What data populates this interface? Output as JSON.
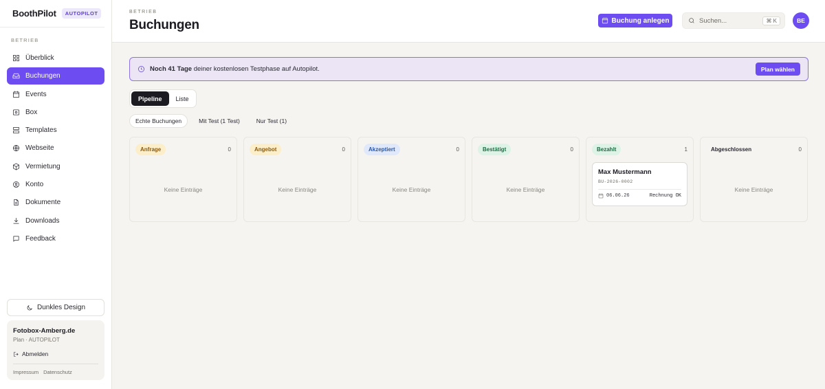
{
  "brand": {
    "name": "BoothPilot",
    "badge": "AUTOPILOT"
  },
  "sidebar": {
    "section_label": "BETRIEB",
    "items": [
      {
        "label": "Überblick",
        "icon": "grid-icon",
        "active": false
      },
      {
        "label": "Buchungen",
        "icon": "inbox-icon",
        "active": true
      },
      {
        "label": "Events",
        "icon": "calendar-icon",
        "active": false
      },
      {
        "label": "Box",
        "icon": "box-icon",
        "active": false
      },
      {
        "label": "Templates",
        "icon": "layout-icon",
        "active": false
      },
      {
        "label": "Webseite",
        "icon": "globe-icon",
        "active": false
      },
      {
        "label": "Vermietung",
        "icon": "package-icon",
        "active": false
      },
      {
        "label": "Konto",
        "icon": "user-circle-icon",
        "active": false
      },
      {
        "label": "Dokumente",
        "icon": "document-icon",
        "active": false
      },
      {
        "label": "Downloads",
        "icon": "download-icon",
        "active": false
      },
      {
        "label": "Feedback",
        "icon": "message-icon",
        "active": false
      }
    ],
    "dark_mode_label": "Dunkles Design",
    "account": {
      "name": "Fotobox-Amberg.de",
      "plan": "Plan · AUTOPILOT",
      "logout_label": "Abmelden",
      "links": [
        "Impressum",
        "Datenschutz"
      ]
    }
  },
  "header": {
    "breadcrumb": "BETRIEB",
    "title": "Buchungen",
    "create_button": "Buchung anlegen",
    "search_placeholder": "Suchen...",
    "search_shortcut": "⌘ K",
    "avatar_initials": "BE"
  },
  "trial": {
    "bold": "Noch 41 Tage",
    "text": " deiner kostenlosen Testphase auf Autopilot.",
    "button": "Plan wählen"
  },
  "view_toggle": [
    {
      "label": "Pipeline",
      "active": true
    },
    {
      "label": "Liste",
      "active": false
    }
  ],
  "filters": [
    {
      "label": "Echte Buchungen",
      "active": true
    },
    {
      "label": "Mit Test (1 Test)",
      "active": false
    },
    {
      "label": "Nur Test (1)",
      "active": false
    }
  ],
  "empty_label": "Keine Einträge",
  "columns": [
    {
      "label": "Anfrage",
      "count": "0",
      "bg": "#fbeec9",
      "fg": "#8a5a12"
    },
    {
      "label": "Angebot",
      "count": "0",
      "bg": "#fbeec9",
      "fg": "#8a5a12"
    },
    {
      "label": "Akzeptiert",
      "count": "0",
      "bg": "#dfe9fb",
      "fg": "#2a56a8"
    },
    {
      "label": "Bestätigt",
      "count": "0",
      "bg": "#dcf3e6",
      "fg": "#1f6b43"
    },
    {
      "label": "Bezahlt",
      "count": "1",
      "bg": "#dcf3e6",
      "fg": "#1f6b43"
    },
    {
      "label": "Abgeschlossen",
      "count": "0",
      "bg": "#f5f4f1",
      "fg": "#2a2830"
    }
  ],
  "booking_card": {
    "name": "Max Mustermann",
    "code": "BU-2026-0002",
    "date": "06.06.26",
    "status": "Rechnung OK"
  }
}
